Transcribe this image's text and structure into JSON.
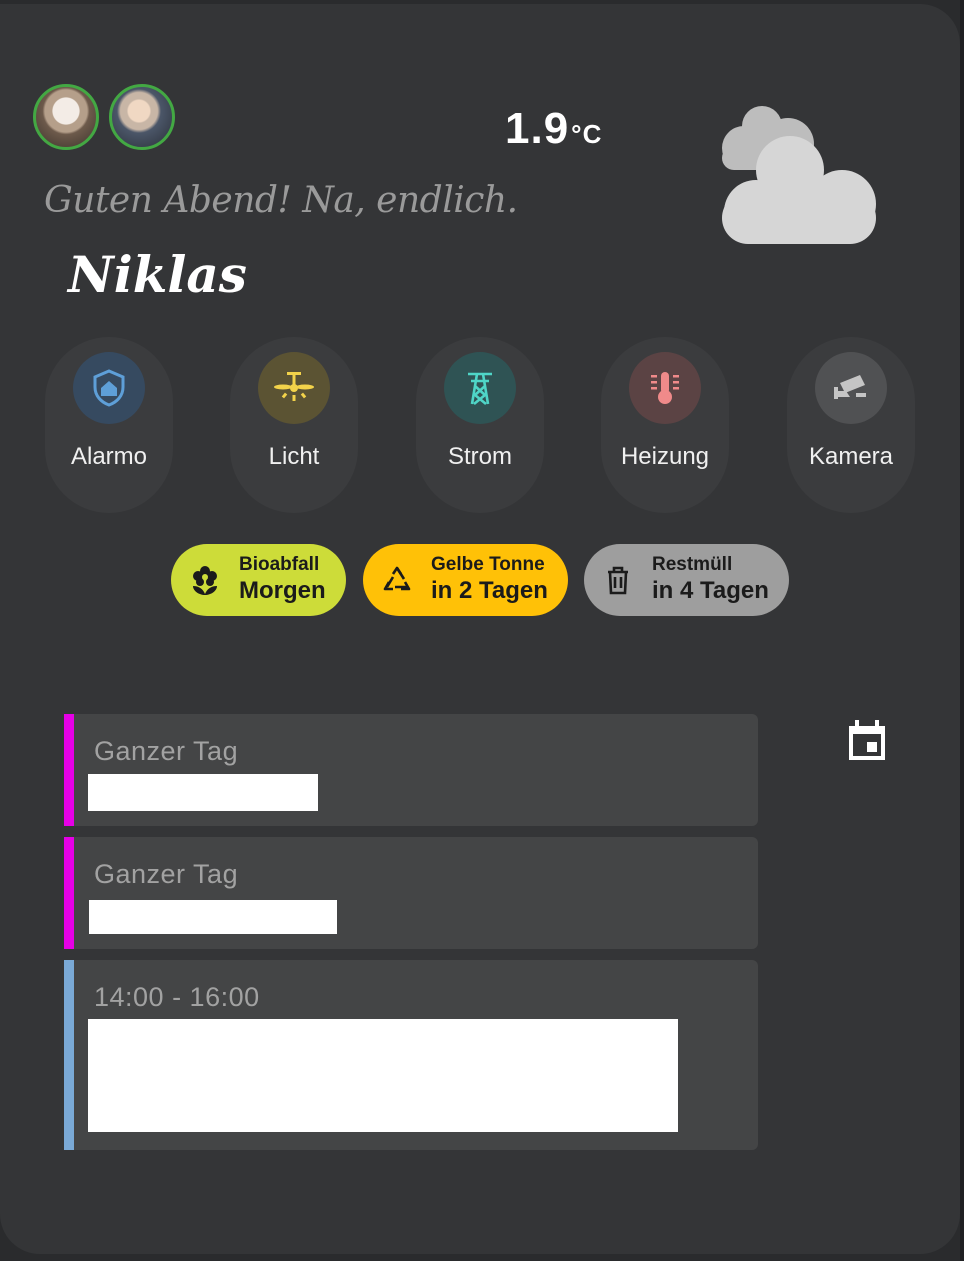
{
  "weather": {
    "temperature": "1.9",
    "unit": "°C",
    "icon": "cloudy-icon"
  },
  "greeting": {
    "text": "Guten Abend! Na, endlich.",
    "name": "Niklas"
  },
  "quick_actions": [
    {
      "label": "Alarmo",
      "icon": "shield-home-icon",
      "color": "#5e9fd8"
    },
    {
      "label": "Licht",
      "icon": "ceiling-fan-light-icon",
      "color": "#f3d34a"
    },
    {
      "label": "Strom",
      "icon": "transmission-tower-icon",
      "color": "#4fd5c7"
    },
    {
      "label": "Heizung",
      "icon": "thermometer-icon",
      "color": "#f08a8a"
    },
    {
      "label": "Kamera",
      "icon": "cctv-icon",
      "color": "#c5c5c5"
    }
  ],
  "waste": [
    {
      "type": "Bioabfall",
      "when": "Morgen",
      "icon": "flower-icon",
      "color": "#cddc39"
    },
    {
      "type": "Gelbe Tonne",
      "when": "in 2 Tagen",
      "icon": "recycle-icon",
      "color": "#ffc107"
    },
    {
      "type": "Restmüll",
      "when": "in 4 Tagen",
      "icon": "trash-can-icon",
      "color": "#9e9e9e"
    }
  ],
  "calendar": {
    "icon": "calendar-icon",
    "events": [
      {
        "time": "Ganzer Tag",
        "color": "#e600e6"
      },
      {
        "time": "Ganzer Tag",
        "color": "#e600e6"
      },
      {
        "time": "14:00 - 16:00",
        "color": "#7aa9d6"
      }
    ]
  }
}
